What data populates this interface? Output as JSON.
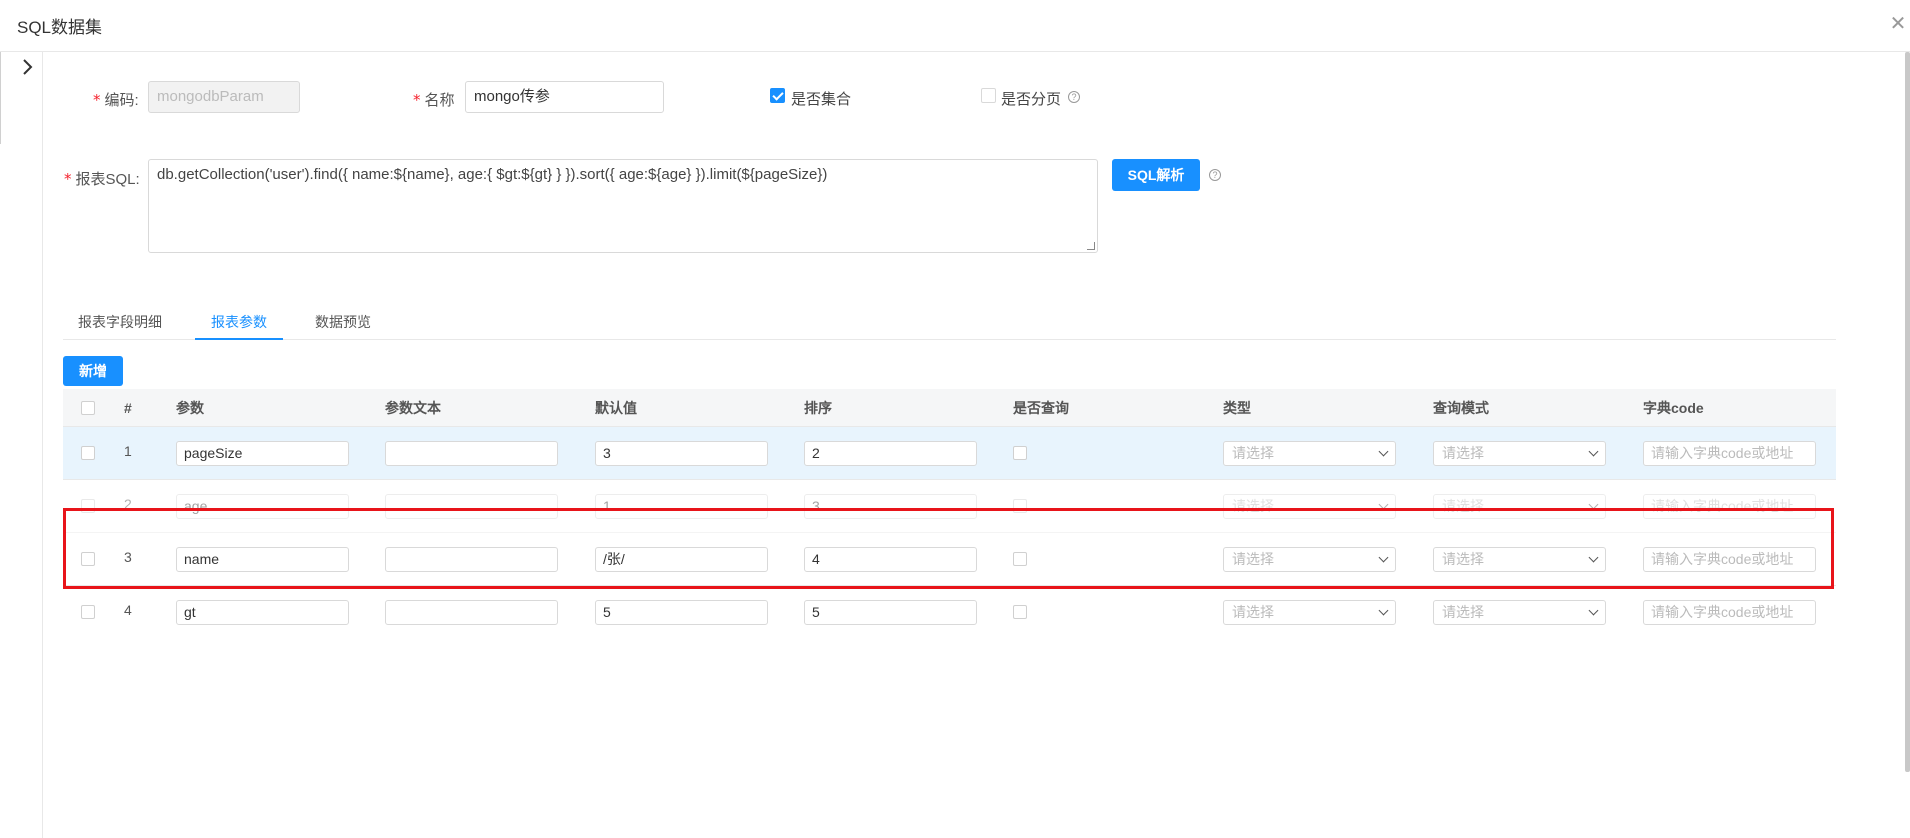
{
  "header": {
    "title": "SQL数据集",
    "close_icon": "close-icon"
  },
  "form": {
    "code_label": "编码:",
    "code_value": "mongodbParam",
    "name_label": "名称",
    "name_value": "mongo传参",
    "is_set_label": "是否集合",
    "is_set_checked": true,
    "is_paged_label": "是否分页",
    "is_paged_checked": false,
    "sql_label": "报表SQL:",
    "sql_value": "db.getCollection('user').find({ name:${name}, age:{ $gt:${gt} } }).sort({ age:${age} }).limit(${pageSize})",
    "parse_button": "SQL解析",
    "required_mark": "*",
    "help_mark": "?"
  },
  "tabs": [
    {
      "label": "报表字段明细",
      "active": false
    },
    {
      "label": "报表参数",
      "active": true
    },
    {
      "label": "数据预览",
      "active": false
    }
  ],
  "add_button": "新增",
  "table": {
    "headers": {
      "index": "#",
      "param": "参数",
      "param_text": "参数文本",
      "default_value": "默认值",
      "order": "排序",
      "is_query": "是否查询",
      "type": "类型",
      "query_mode": "查询模式",
      "dict_code": "字典code"
    },
    "select_placeholder": "请选择",
    "dict_placeholder": "请输入字典code或地址",
    "rows": [
      {
        "num": "1",
        "param": "pageSize",
        "param_text": "",
        "default_value": "3",
        "order": "2"
      },
      {
        "num": "2",
        "param": "age",
        "param_text": "",
        "default_value": "1",
        "order": "3"
      },
      {
        "num": "3",
        "param": "name",
        "param_text": "",
        "default_value": "/张/",
        "order": "4"
      },
      {
        "num": "4",
        "param": "gt",
        "param_text": "",
        "default_value": "5",
        "order": "5"
      }
    ]
  },
  "colors": {
    "accent": "#1890ff",
    "highlight": "#e8141a",
    "required": "#f5222d"
  }
}
